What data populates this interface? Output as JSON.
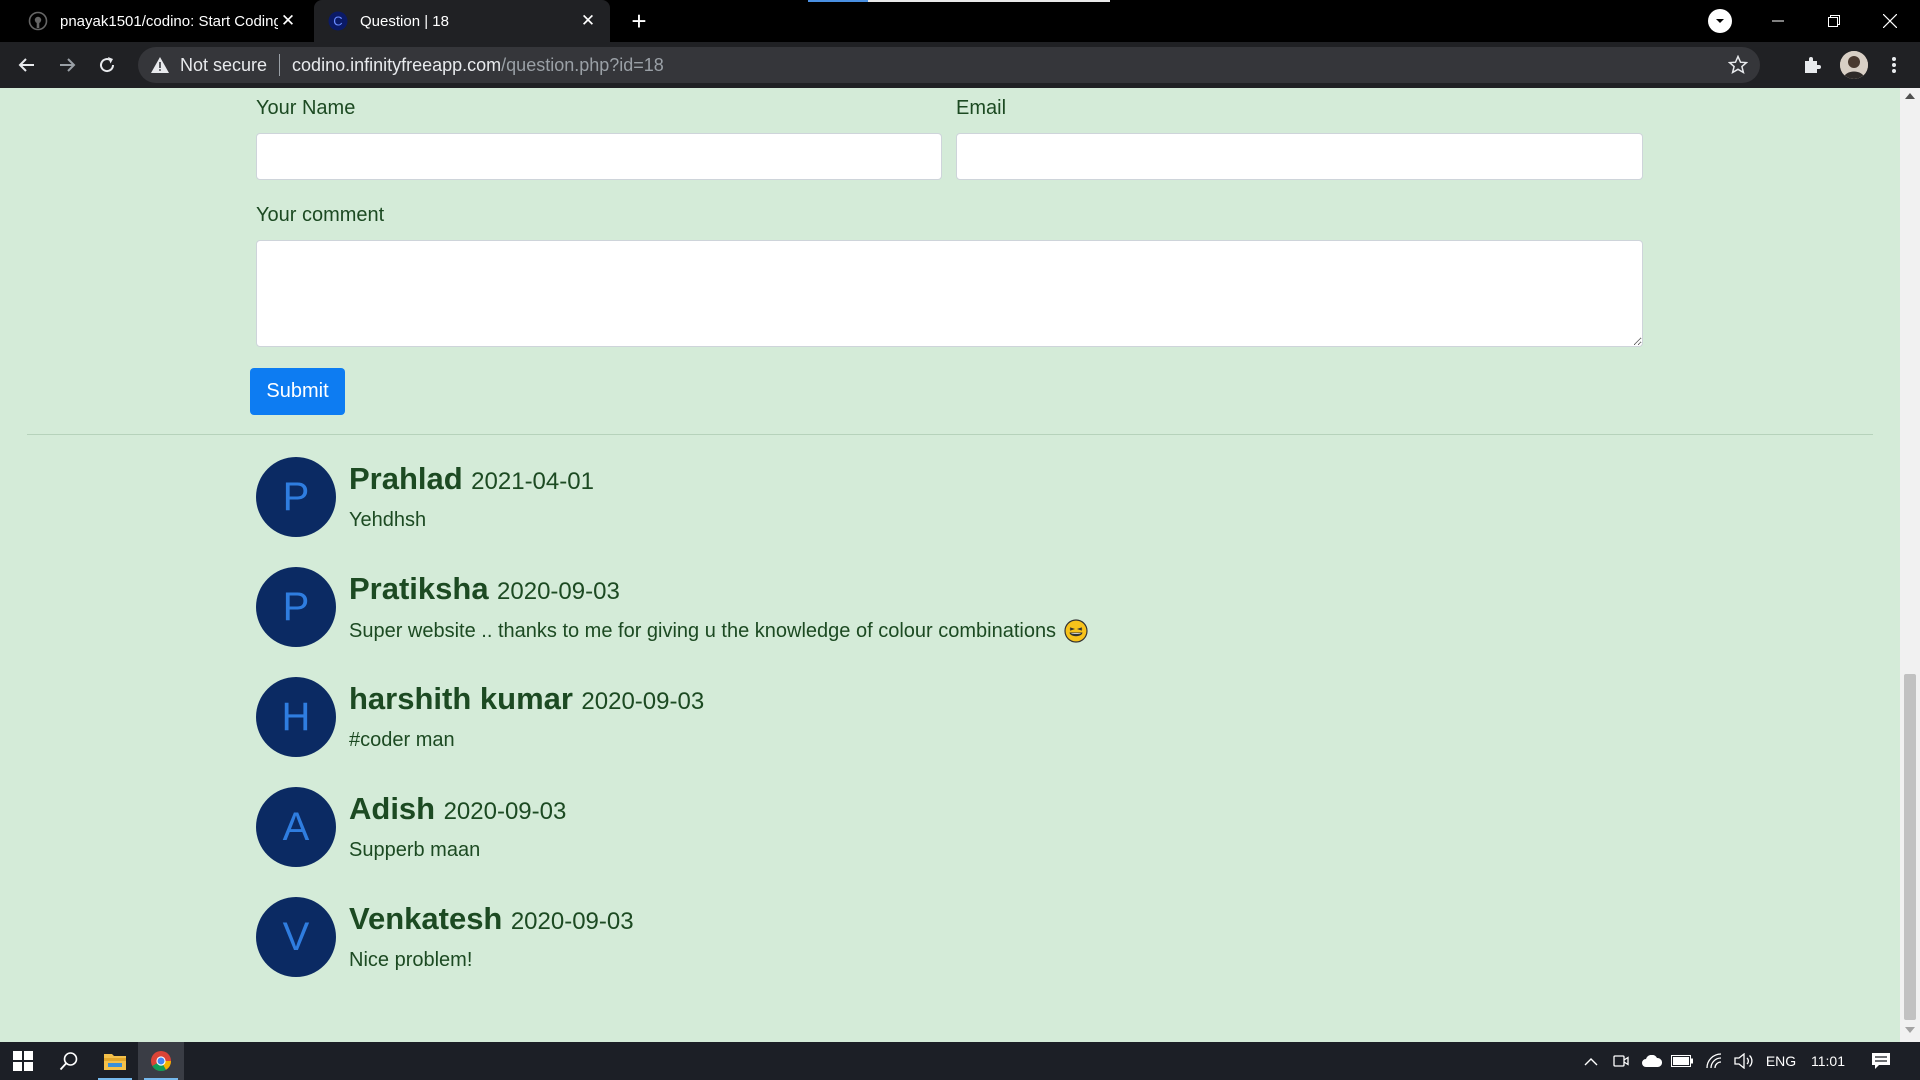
{
  "browser": {
    "tabs": [
      {
        "title": "pnayak1501/codino: Start Coding",
        "icon": "github-icon",
        "active": false
      },
      {
        "title": "Question | 18",
        "icon": "codino-c-icon",
        "active": true
      }
    ],
    "security_label": "Not secure",
    "url_host": "codino.infinityfreeapp.com",
    "url_path": "/question.php?id=18"
  },
  "form": {
    "name_label": "Your Name",
    "email_label": "Email",
    "comment_label": "Your comment",
    "name_value": "",
    "email_value": "",
    "comment_value": "",
    "submit_label": "Submit"
  },
  "comments": [
    {
      "initial": "P",
      "name": "Prahlad",
      "date": "2021-04-01",
      "text": "Yehdhsh",
      "emoji": false
    },
    {
      "initial": "P",
      "name": "Pratiksha",
      "date": "2020-09-03",
      "text": "Super website .. thanks to me for giving u the knowledge of colour combinations",
      "emoji": true
    },
    {
      "initial": "H",
      "name": "harshith kumar",
      "date": "2020-09-03",
      "text": "#coder man",
      "emoji": false
    },
    {
      "initial": "A",
      "name": "Adish",
      "date": "2020-09-03",
      "text": "Supperb maan",
      "emoji": false
    },
    {
      "initial": "V",
      "name": "Venkatesh",
      "date": "2020-09-03",
      "text": "Nice problem!",
      "emoji": false
    }
  ],
  "taskbar": {
    "language": "ENG",
    "time": "11:01"
  },
  "colors": {
    "page_background": "#d4ebd8",
    "text_green": "#1c4a22",
    "avatar_background": "#0b2a63",
    "avatar_letter": "#2f7de0",
    "submit_button": "#0d7cf2"
  }
}
